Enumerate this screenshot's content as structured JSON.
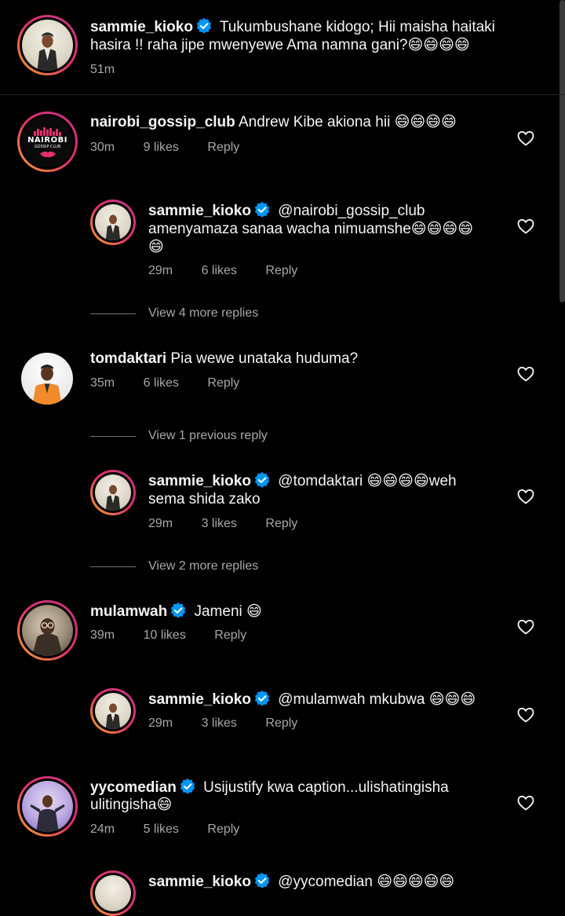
{
  "colors": {
    "background": "#000000",
    "text_primary": "#f5f5f5",
    "text_secondary": "#a8a8a8",
    "verified_blue": "#0095f6",
    "ring_gradient": [
      "#f9a825",
      "#e1306c",
      "#c13584"
    ]
  },
  "icons": {
    "verified": "verified-badge-icon",
    "like": "heart-outline-icon",
    "emoji": "grinning-face-emoji"
  },
  "caption": {
    "username": "sammie_kioko",
    "verified": true,
    "text_line1": "Tukumbushane kidogo; Hii maisha haitaki",
    "text_line2": "hasira !! raha jipe mwenyewe Ama namna gani?😄😄😄😄",
    "time": "51m"
  },
  "gossip_avatar": {
    "title": "NAIROBI",
    "subtitle": "GOSSIP CLUB"
  },
  "comments": [
    {
      "username": "nairobi_gossip_club",
      "text_line1": "Andrew Kibe akiona hii 😄😄😄😄",
      "time": "30m",
      "likes": "9 likes",
      "reply_label": "Reply"
    },
    {
      "username": "sammie_kioko",
      "text_line1": "@nairobi_gossip_club",
      "text_line2": "amenyamaza sanaa wacha nimuamshe😄😄😄😄",
      "text_line3": "😄",
      "time": "29m",
      "likes": "6 likes",
      "reply_label": "Reply"
    },
    {
      "username": "tomdaktari",
      "text_line1": "Pia wewe unataka huduma?",
      "time": "35m",
      "likes": "6 likes",
      "reply_label": "Reply"
    },
    {
      "username": "sammie_kioko",
      "text_line1": "@tomdaktari 😄😄😄😄weh",
      "text_line2": "sema shida zako",
      "time": "29m",
      "likes": "3 likes",
      "reply_label": "Reply"
    },
    {
      "username": "mulamwah",
      "text_line1": "Jameni 😄",
      "time": "39m",
      "likes": "10 likes",
      "reply_label": "Reply"
    },
    {
      "username": "sammie_kioko",
      "text_line1": "@mulamwah mkubwa 😄😄😄",
      "time": "29m",
      "likes": "3 likes",
      "reply_label": "Reply"
    },
    {
      "username": "yycomedian",
      "text_line1": "Usijustify kwa caption...ulishatingisha",
      "text_line2": "ulitingisha😄",
      "time": "24m",
      "likes": "5 likes",
      "reply_label": "Reply"
    },
    {
      "username": "sammie_kioko",
      "text_line1": "@yycomedian 😄😄😄😄😄"
    }
  ],
  "view_replies": {
    "more_4": "View 4 more replies",
    "previous_1": "View 1 previous reply",
    "more_2": "View 2 more replies"
  }
}
